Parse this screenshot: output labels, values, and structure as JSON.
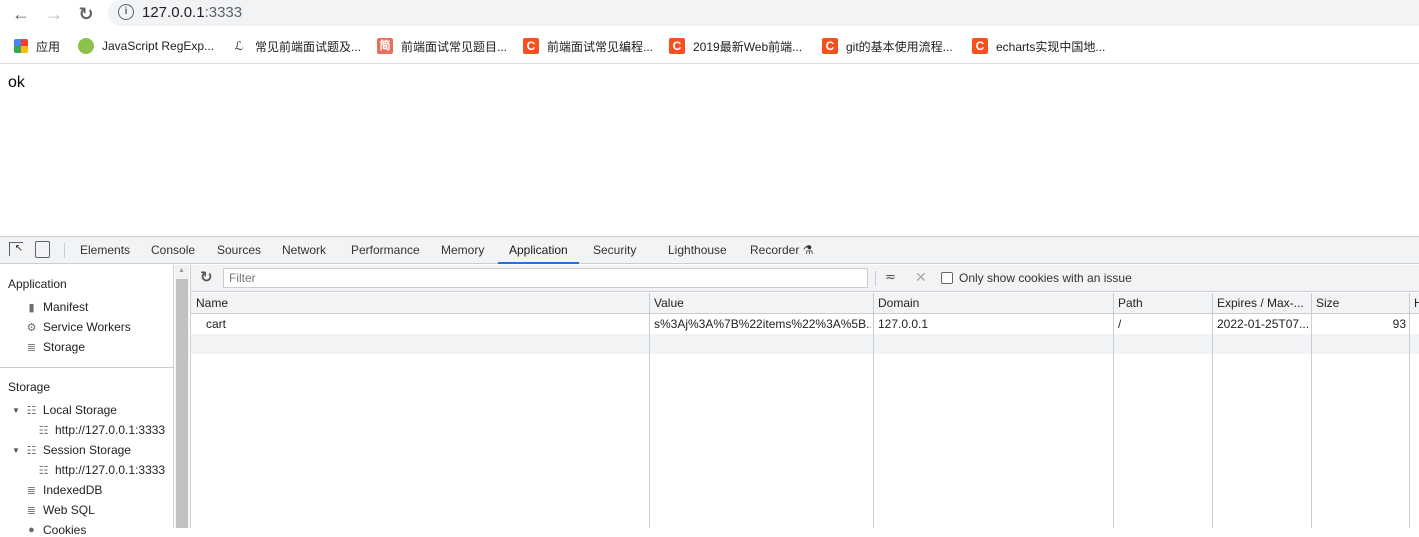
{
  "browser": {
    "url_host": "127.0.0.1",
    "url_port": ":3333",
    "back": "←",
    "forward": "→",
    "reload": "↻"
  },
  "bookmarks": [
    {
      "label": "应用",
      "icon": "apps-grid-icon"
    },
    {
      "label": "JavaScript RegExp...",
      "icon": "regexp-site-icon"
    },
    {
      "label": "常见前端面试题及...",
      "icon": "bookmark-site-icon"
    },
    {
      "label": "前端面试常见题目...",
      "icon": "jianshu-icon",
      "glyph": "简"
    },
    {
      "label": "前端面试常见编程...",
      "icon": "csdn-icon",
      "glyph": "C"
    },
    {
      "label": "2019最新Web前端...",
      "icon": "csdn-icon",
      "glyph": "C"
    },
    {
      "label": "git的基本使用流程...",
      "icon": "csdn-icon",
      "glyph": "C"
    },
    {
      "label": "echarts实现中国地...",
      "icon": "csdn-icon",
      "glyph": "C"
    }
  ],
  "page": {
    "text": "ok"
  },
  "devtools": {
    "tabs": [
      "Elements",
      "Console",
      "Sources",
      "Network",
      "Performance",
      "Memory",
      "Application",
      "Security",
      "Lighthouse",
      "Recorder ⚗"
    ],
    "active_tab": "Application",
    "sidebar": {
      "application_header": "Application",
      "application_items": [
        "Manifest",
        "Service Workers",
        "Storage"
      ],
      "storage_header": "Storage",
      "local_storage": "Local Storage",
      "local_origin": "http://127.0.0.1:3333",
      "session_storage": "Session Storage",
      "session_origin": "http://127.0.0.1:3333",
      "indexeddb": "IndexedDB",
      "websql": "Web SQL",
      "cookies": "Cookies"
    },
    "toolbar": {
      "filter_placeholder": "Filter",
      "only_issue_label": "Only show cookies with an issue"
    },
    "table": {
      "columns": [
        "Name",
        "Value",
        "Domain",
        "Path",
        "Expires / Max-...",
        "Size",
        "H"
      ],
      "rows": [
        [
          "cart",
          "s%3Aj%3A%7B%22items%22%3A%5B...",
          "127.0.0.1",
          "/",
          "2022-01-25T07...",
          "93"
        ]
      ]
    }
  }
}
